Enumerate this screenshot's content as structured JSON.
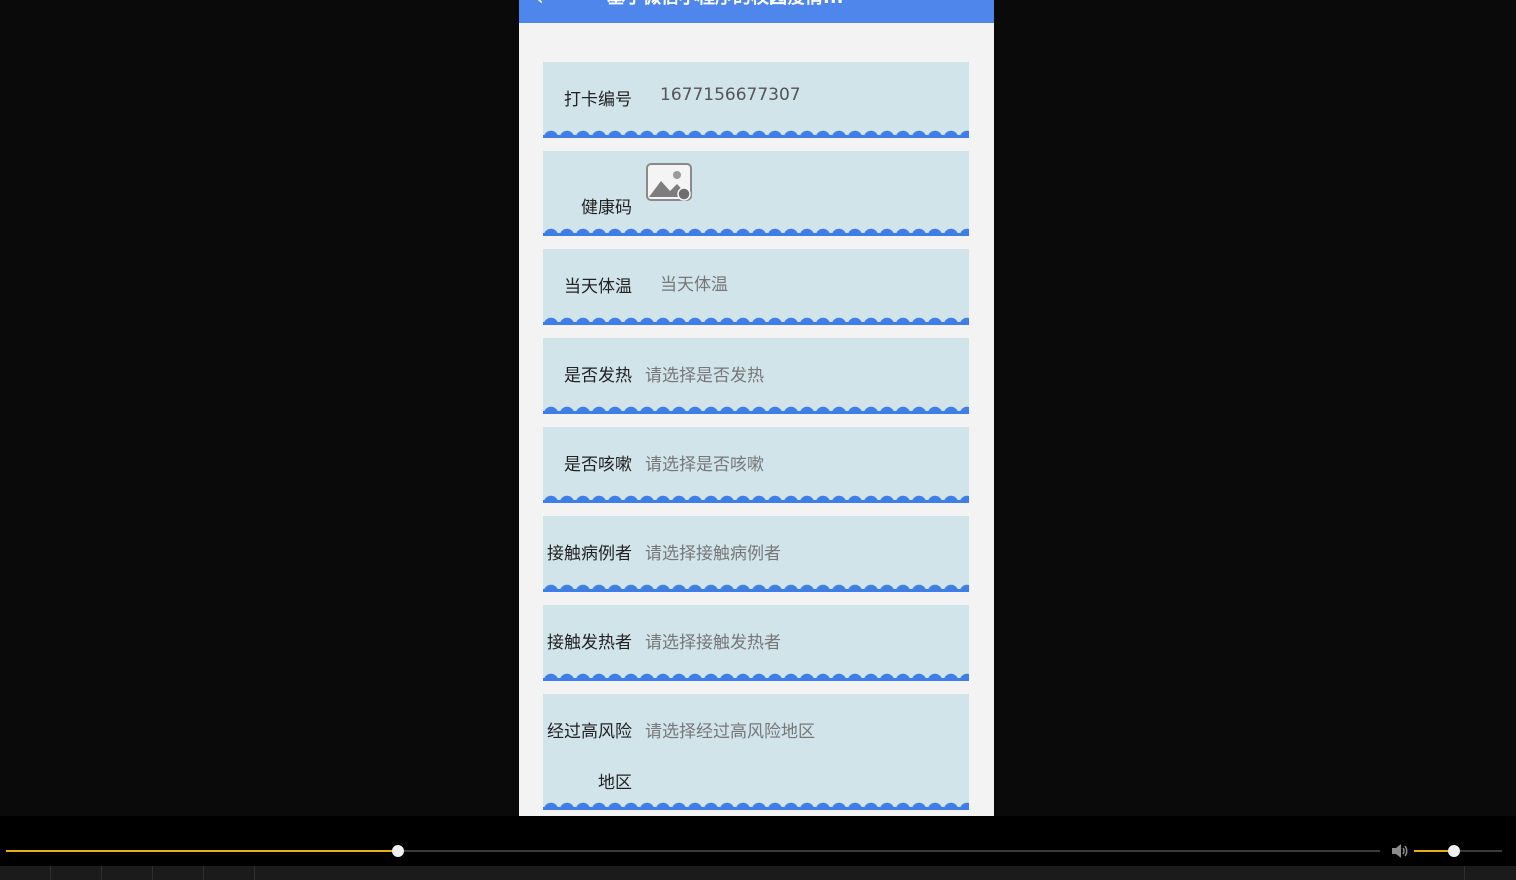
{
  "app": {
    "header_title": "基于微信小程序的校园疫情...",
    "back_icon": "chevron-left-icon"
  },
  "form": {
    "fields": [
      {
        "label": "打卡编号",
        "value": "1677156677307",
        "kind": "text"
      },
      {
        "label": "健康码",
        "value": "",
        "kind": "image",
        "icon": "image-placeholder-icon"
      },
      {
        "label": "当天体温",
        "placeholder": "当天体温",
        "kind": "input"
      },
      {
        "label": "是否发热",
        "placeholder": "请选择是否发热",
        "kind": "select"
      },
      {
        "label": "是否咳嗽",
        "placeholder": "请选择是否咳嗽",
        "kind": "select"
      },
      {
        "label": "接触病例者",
        "placeholder": "请选择接触病例者",
        "kind": "select"
      },
      {
        "label": "接触发热者",
        "placeholder": "请选择接触发热者",
        "kind": "select"
      },
      {
        "label_line1": "经过高风险",
        "label_line2": "地区",
        "placeholder": "请选择经过高风险地区",
        "kind": "select"
      }
    ]
  },
  "player": {
    "progress": 0.285,
    "volume": 0.45,
    "volume_icon": "speaker-icon",
    "colors": {
      "accent": "#e5b20c",
      "header": "#4f86ec",
      "card": "#d1e4ea",
      "wave": "#3f7ee7"
    }
  }
}
